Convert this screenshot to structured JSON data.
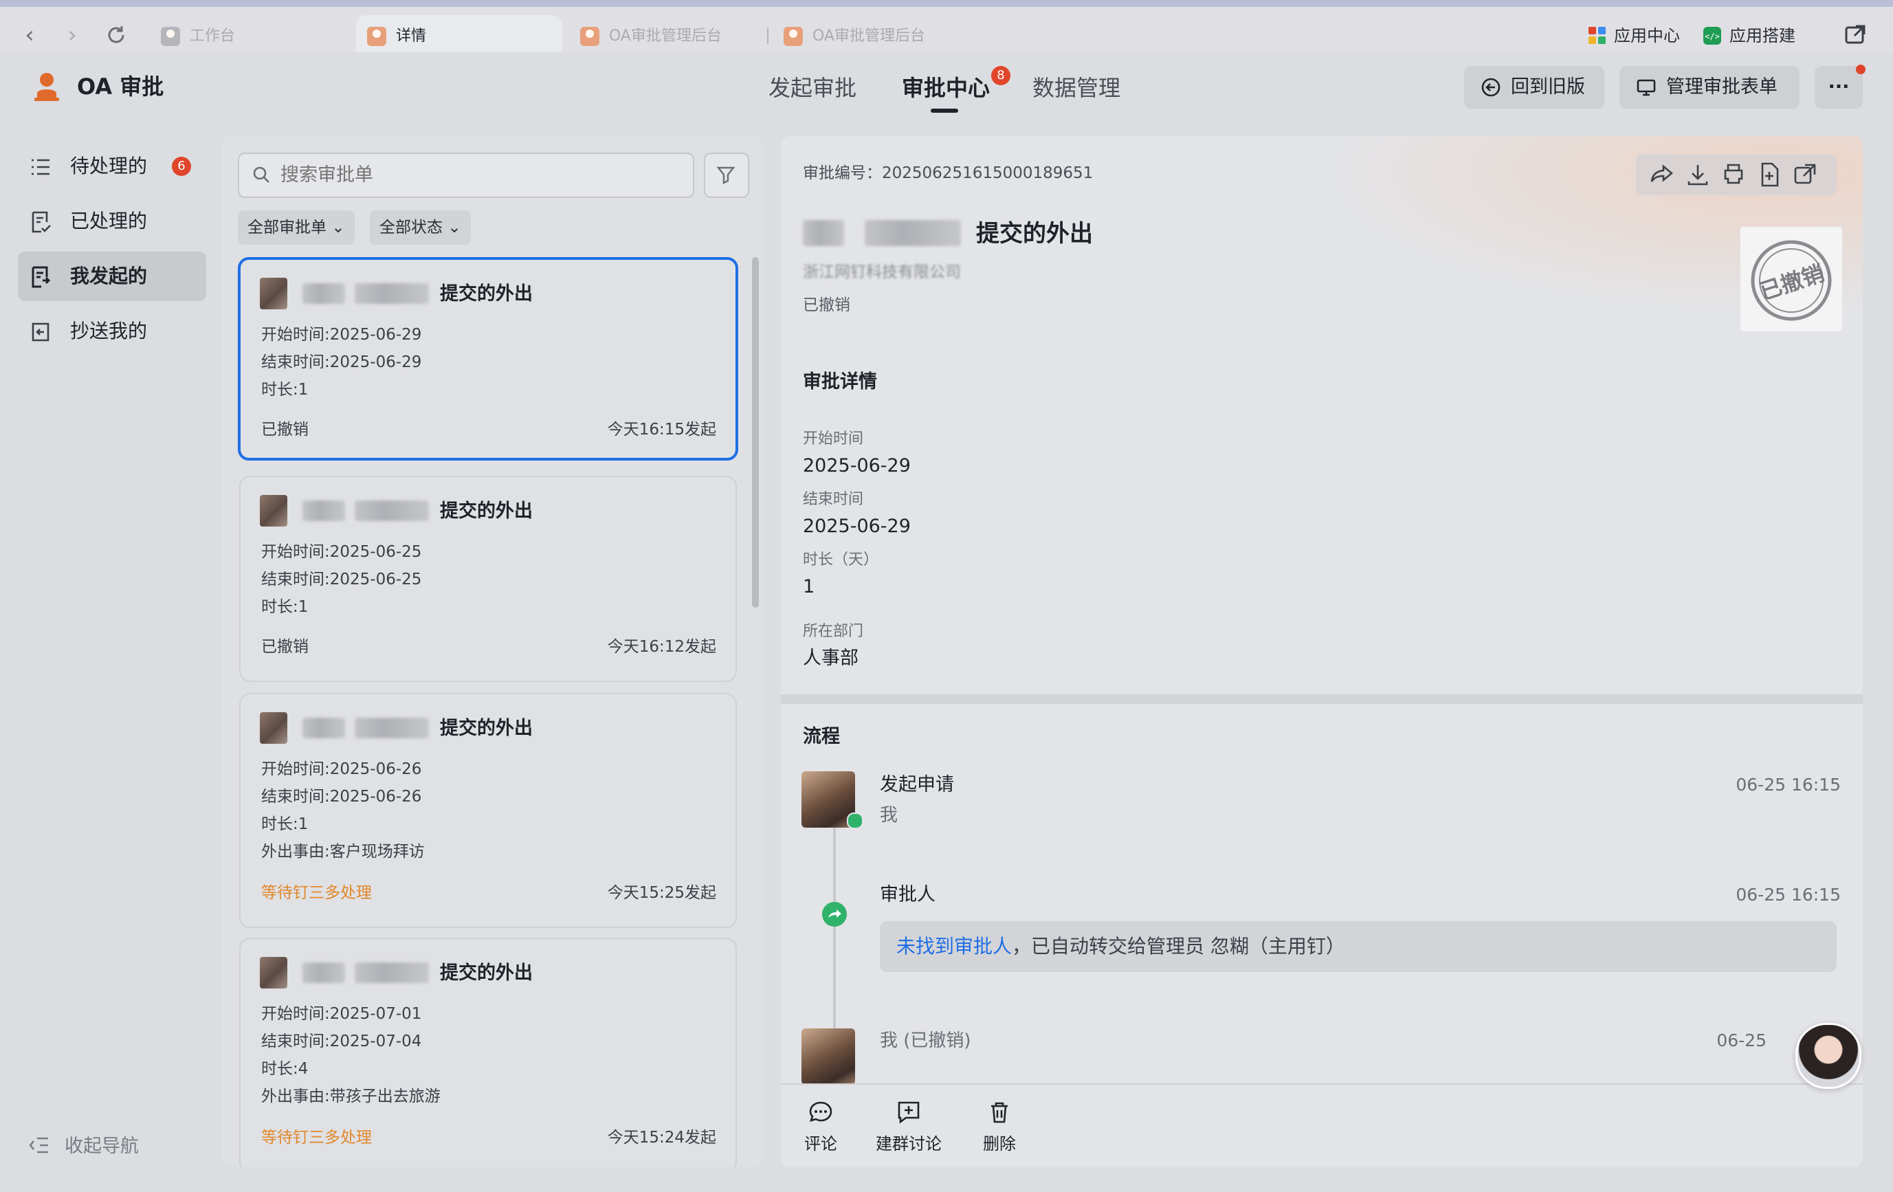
{
  "tabs": [
    {
      "label": "工作台"
    },
    {
      "label": "详情"
    },
    {
      "label": "OA审批管理后台"
    },
    {
      "label": "OA审批管理后台"
    }
  ],
  "top_right": {
    "app_center": "应用中心",
    "app_builder": "应用搭建"
  },
  "header": {
    "brand": "OA 审批",
    "nav": [
      {
        "label": "发起审批"
      },
      {
        "label": "审批中心"
      },
      {
        "label": "数据管理"
      }
    ],
    "nav_badge": "8",
    "back_old": "回到旧版",
    "manage_forms": "管理审批表单",
    "more": "···"
  },
  "sidebar": {
    "items": [
      {
        "label": "待处理的",
        "badge": "6"
      },
      {
        "label": "已处理的"
      },
      {
        "label": "我发起的"
      },
      {
        "label": "抄送我的"
      }
    ],
    "collapse": "收起导航"
  },
  "list": {
    "search_placeholder": "搜索审批单",
    "filter_all_forms": "全部审批单",
    "filter_all_status": "全部状态",
    "cards": [
      {
        "title": "提交的外出",
        "lines": [
          "开始时间:2025-06-29",
          "结束时间:2025-06-29",
          "时长:1"
        ],
        "status": "已撤销",
        "time": "今天16:15发起"
      },
      {
        "title": "提交的外出",
        "lines": [
          "开始时间:2025-06-25",
          "结束时间:2025-06-25",
          "时长:1"
        ],
        "status": "已撤销",
        "time": "今天16:12发起"
      },
      {
        "title": "提交的外出",
        "lines": [
          "开始时间:2025-06-26",
          "结束时间:2025-06-26",
          "时长:1",
          "外出事由:客户现场拜访"
        ],
        "status": "等待钉三多处理",
        "time": "今天15:25发起"
      },
      {
        "title": "提交的外出",
        "lines": [
          "开始时间:2025-07-01",
          "结束时间:2025-07-04",
          "时长:4",
          "外出事由:带孩子出去旅游"
        ],
        "status": "等待钉三多处理",
        "time": "今天15:24发起"
      }
    ]
  },
  "detail": {
    "serial_label": "审批编号：",
    "serial": "202506251615000189651",
    "title": "提交的外出",
    "company": "浙江网钉科技有限公司",
    "status": "已撤销",
    "stamp_text": "已撤销",
    "section_title": "审批详情",
    "fields": [
      {
        "label": "开始时间",
        "value": "2025-06-29"
      },
      {
        "label": "结束时间",
        "value": "2025-06-29"
      },
      {
        "label": "时长（天）",
        "value": "1"
      },
      {
        "label": "所在部门",
        "value": "人事部"
      }
    ],
    "flow_title": "流程",
    "flow": [
      {
        "title": "发起申请",
        "sub": "我",
        "time": "06-25 16:15"
      },
      {
        "title": "审批人",
        "time": "06-25 16:15",
        "note_link": "未找到审批人",
        "note_rest": "，已自动转交给管理员 忽糊（主用钉）"
      },
      {
        "title": "我 (已撤销)",
        "time": "06-25"
      }
    ],
    "actions": [
      {
        "label": "评论"
      },
      {
        "label": "建群讨论"
      },
      {
        "label": "删除"
      }
    ]
  },
  "colors": {
    "accent_blue": "#1f6fe5",
    "badge_red": "#e0452b",
    "pending_orange": "#e0882c",
    "link_blue": "#1f6fe5"
  }
}
